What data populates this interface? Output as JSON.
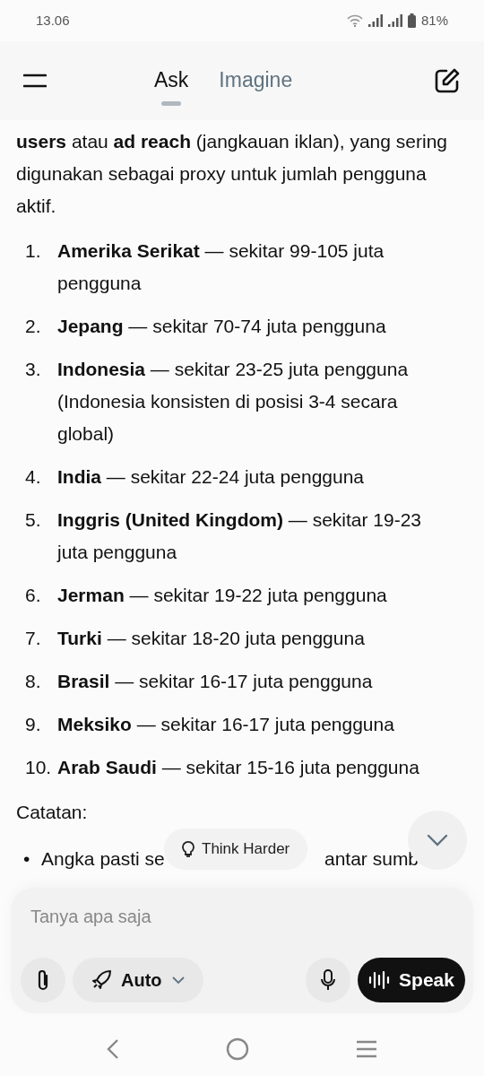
{
  "status_bar": {
    "time": "13.06",
    "battery": "81%"
  },
  "tabs": [
    {
      "label": "Ask",
      "selected": true
    },
    {
      "label": "Imagine",
      "selected": false
    }
  ],
  "intro": "**users** atau **ad reach** (jangkauan iklan), yang sering digunakan sebagai proxy untuk jumlah pengguna aktif.",
  "ranking": [
    {
      "number": "1.",
      "text": "**Amerika Serikat** — sekitar 99-105 juta pengguna"
    },
    {
      "number": "2.",
      "text": "**Jepang** — sekitar 70-74 juta pengguna"
    },
    {
      "number": "3.",
      "text": "**Indonesia** — sekitar 23-25 juta pengguna (Indonesia konsisten di posisi 3-4 secara global)"
    },
    {
      "number": "4.",
      "text": "**India** — sekitar 22-24 juta pengguna"
    },
    {
      "number": "5.",
      "text": "**Inggris (United Kingdom)** — sekitar 19-23 juta pengguna"
    },
    {
      "number": "6.",
      "text": "**Jerman** — sekitar 19-22 juta pengguna"
    },
    {
      "number": "7.",
      "text": "**Turki** — sekitar 18-20 juta pengguna"
    },
    {
      "number": "8.",
      "text": "**Brasil** — sekitar 16-17 juta pengguna"
    },
    {
      "number": "9.",
      "text": "**Meksiko** — sekitar 16-17 juta pengguna"
    },
    {
      "number": "10.",
      "text": "**Arab Saudi** — sekitar 15-16 juta pengguna"
    }
  ],
  "notes_heading": "Catatan:",
  "note_bullet": {
    "marker": "•",
    "visible_start": "Angka pasti se",
    "visible_end": "antar sumb"
  },
  "think_harder": "Think Harder",
  "composer": {
    "placeholder": "Tanya apa saja",
    "mode": "Auto",
    "speak": "Speak"
  }
}
